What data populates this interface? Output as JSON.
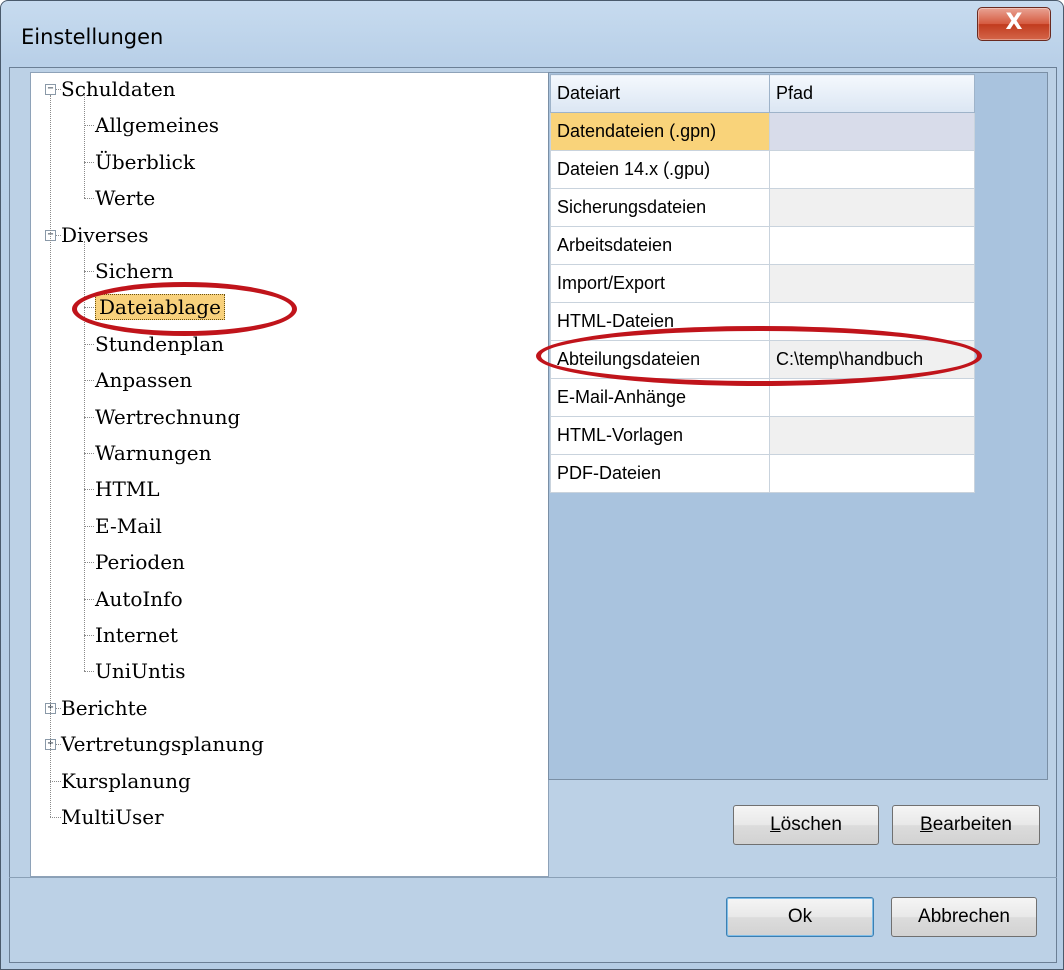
{
  "window": {
    "title": "Einstellungen",
    "close_symbol": "X"
  },
  "tree": {
    "groups": [
      {
        "label": "Schuldaten",
        "expander": "−",
        "children": [
          "Allgemeines",
          "Überblick",
          "Werte"
        ]
      },
      {
        "label": "Diverses",
        "expander": "−",
        "children": [
          "Sichern",
          "Dateiablage",
          "Stundenplan",
          "Anpassen",
          "Wertrechnung",
          "Warnungen",
          "HTML",
          "E-Mail",
          "Perioden",
          "AutoInfo",
          "Internet",
          "UniUntis"
        ]
      },
      {
        "label": "Berichte",
        "expander": "+"
      },
      {
        "label": "Vertretungsplanung",
        "expander": "+"
      },
      {
        "label": "Kursplanung"
      },
      {
        "label": "MultiUser"
      }
    ],
    "selected": "Dateiablage"
  },
  "grid": {
    "headers": [
      "Dateiart",
      "Pfad"
    ],
    "rows": [
      {
        "type": "Datendateien (.gpn)",
        "path": ""
      },
      {
        "type": "Dateien 14.x (.gpu)",
        "path": ""
      },
      {
        "type": "Sicherungsdateien",
        "path": ""
      },
      {
        "type": "Arbeitsdateien",
        "path": ""
      },
      {
        "type": "Import/Export",
        "path": ""
      },
      {
        "type": "HTML-Dateien",
        "path": ""
      },
      {
        "type": "Abteilungsdateien",
        "path": "C:\\temp\\handbuch"
      },
      {
        "type": "E-Mail-Anhänge",
        "path": ""
      },
      {
        "type": "HTML-Vorlagen",
        "path": ""
      },
      {
        "type": "PDF-Dateien",
        "path": ""
      }
    ],
    "active_row": 0
  },
  "buttons": {
    "loeschen_first": "L",
    "loeschen_rest": "öschen",
    "bearbeiten_first": "B",
    "bearbeiten_rest": "earbeiten",
    "ok": "Ok",
    "abbrechen": "Abbrechen"
  },
  "colors": {
    "highlight": "#c0141b",
    "selection": "#f9d37a"
  }
}
